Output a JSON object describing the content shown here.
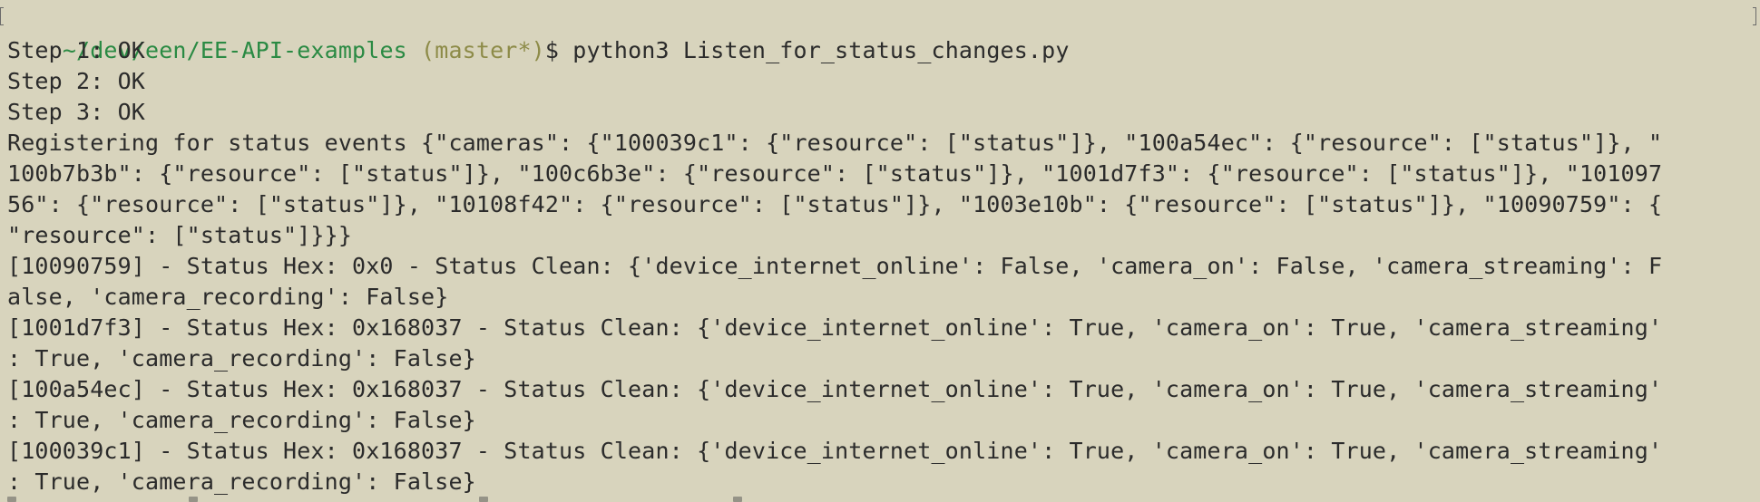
{
  "prompt": {
    "path": "~/dev/een/EE-API-examples",
    "branch": " (master*)",
    "symbol": "$ ",
    "command": "python3 Listen_for_status_changes.py"
  },
  "output_lines": [
    "Step 1: OK",
    "Step 2: OK",
    "Step 3: OK",
    "Registering for status events {\"cameras\": {\"100039c1\": {\"resource\": [\"status\"]}, \"100a54ec\": {\"resource\": [\"status\"]}, \"",
    "100b7b3b\": {\"resource\": [\"status\"]}, \"100c6b3e\": {\"resource\": [\"status\"]}, \"1001d7f3\": {\"resource\": [\"status\"]}, \"101097",
    "56\": {\"resource\": [\"status\"]}, \"10108f42\": {\"resource\": [\"status\"]}, \"1003e10b\": {\"resource\": [\"status\"]}, \"10090759\": {",
    "\"resource\": [\"status\"]}}}",
    "[10090759] - Status Hex: 0x0 - Status Clean: {'device_internet_online': False, 'camera_on': False, 'camera_streaming': F",
    "alse, 'camera_recording': False}",
    "[1001d7f3] - Status Hex: 0x168037 - Status Clean: {'device_internet_online': True, 'camera_on': True, 'camera_streaming'",
    ": True, 'camera_recording': False}",
    "[100a54ec] - Status Hex: 0x168037 - Status Clean: {'device_internet_online': True, 'camera_on': True, 'camera_streaming'",
    ": True, 'camera_recording': False}",
    "[100039c1] - Status Hex: 0x168037 - Status Clean: {'device_internet_online': True, 'camera_on': True, 'camera_streaming'",
    ": True, 'camera_recording': False}"
  ],
  "colors": {
    "background": "#d8d4bd",
    "text": "#2b2b2b",
    "path": "#2a8a43",
    "branch": "#8d8b48"
  }
}
